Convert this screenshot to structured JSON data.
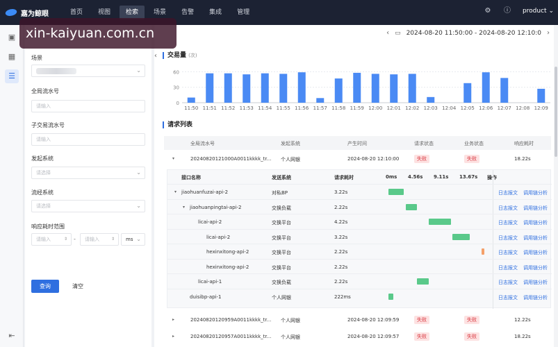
{
  "app": {
    "logo_text": "嘉为鲸眼",
    "user": "product"
  },
  "nav": [
    "首页",
    "视图",
    "检索",
    "场景",
    "告警",
    "集成",
    "管理"
  ],
  "nav_active_index": 2,
  "overlay": {
    "watermark": "xin-kaiyuan.com.cn"
  },
  "filter": {
    "scene_label": "场景",
    "global_id_label": "全局流水号",
    "global_id_placeholder": "请输入",
    "sub_id_label": "子交易流水号",
    "sub_id_placeholder": "请输入",
    "origin_label": "发起系统",
    "origin_placeholder": "请选择",
    "flow_label": "流经系统",
    "flow_placeholder": "请选择",
    "range_label": "响应耗时范围",
    "range_min_placeholder": "请输入",
    "range_max_placeholder": "请输入",
    "range_sep": "-",
    "range_unit": "ms",
    "query_button": "查询",
    "clear_button": "清空"
  },
  "timebar": {
    "range": "2024-08-20 11:50:00 - 2024-08-20 12:10:0"
  },
  "chart_section": {
    "title": "交易量",
    "unit": "(次)"
  },
  "chart_data": {
    "type": "bar",
    "categories": [
      "11:50",
      "11:51",
      "11:52",
      "11:53",
      "11:54",
      "11:55",
      "11:56",
      "11:57",
      "11:58",
      "11:59",
      "12:00",
      "12:01",
      "12:02",
      "12:03",
      "12:04",
      "12:05",
      "12:06",
      "12:07",
      "12:08",
      "12:09"
    ],
    "values": [
      10,
      57,
      57,
      55,
      57,
      56,
      59,
      9,
      47,
      58,
      56,
      55,
      56,
      11,
      0,
      38,
      59,
      48,
      0,
      27
    ],
    "yticks": [
      0,
      30,
      60
    ],
    "ylim": [
      0,
      70
    ],
    "color": "#4a8af4",
    "grid": true
  },
  "list_section": {
    "title": "请求列表"
  },
  "table": {
    "headers": [
      "全局流水号",
      "发起系统",
      "产生时间",
      "请求状态",
      "业务状态",
      "响应耗时"
    ],
    "rows": [
      {
        "id": "20240820121000A0011kkkk_tr...",
        "origin": "个人网银",
        "time": "2024-08-20 12:10:00",
        "req_status": "失败",
        "biz_status": "失败",
        "duration": "18.22s",
        "expanded": true
      },
      {
        "id": "20240820120959A0011kkkk_tr...",
        "origin": "个人网银",
        "time": "2024-08-20 12:09:59",
        "req_status": "失败",
        "biz_status": "失败",
        "duration": "12.22s",
        "expanded": false
      },
      {
        "id": "20240820120957A0011kkkk_tr...",
        "origin": "个人网银",
        "time": "2024-08-20 12:09:57",
        "req_status": "失败",
        "biz_status": "失败",
        "duration": "18.22s",
        "expanded": false
      }
    ]
  },
  "detail": {
    "headers": {
      "name": "接口名称",
      "system": "发送系统",
      "duration": "请求耗时",
      "ops": "操作"
    },
    "timeline_ticks": [
      "0ms",
      "4.56s",
      "9.11s",
      "13.67s"
    ],
    "link_log": "日志报文",
    "link_chain": "调用链分析",
    "rows": [
      {
        "name": "jiaohuanfuzai-api-2",
        "system": "对私BP",
        "duration": "3.22s",
        "bar_start": 0.0,
        "bar_width": 0.16,
        "color": "#5ac98a"
      },
      {
        "name": "jiaohuanpingtai-api-2",
        "system": "交换负载",
        "duration": "2.22s",
        "bar_start": 0.18,
        "bar_width": 0.12,
        "color": "#5ac98a"
      },
      {
        "name": "licai-api-2",
        "system": "交换平台",
        "duration": "4.22s",
        "bar_start": 0.42,
        "bar_width": 0.23,
        "color": "#5ac98a"
      },
      {
        "name": "licai-api-2",
        "system": "交换平台",
        "duration": "3.22s",
        "bar_start": 0.67,
        "bar_width": 0.18,
        "color": "#5ac98a"
      },
      {
        "name": "hexinxitong-api-2",
        "system": "交换平台",
        "duration": "2.22s",
        "bar_start": 0.97,
        "bar_width": 0.03,
        "color": "#f4a06a"
      },
      {
        "name": "hexinxitong-api-2",
        "system": "交换平台",
        "duration": "2.22s",
        "bar_start": 0.0,
        "bar_width": 0.0,
        "color": "#5ac98a"
      },
      {
        "name": "licai-api-1",
        "system": "交换负载",
        "duration": "2.22s",
        "bar_start": 0.3,
        "bar_width": 0.12,
        "color": "#5ac98a"
      },
      {
        "name": "duisibp-api-1",
        "system": "个人网银",
        "duration": "222ms",
        "bar_start": 0.0,
        "bar_width": 0.05,
        "color": "#5ac98a"
      }
    ]
  }
}
